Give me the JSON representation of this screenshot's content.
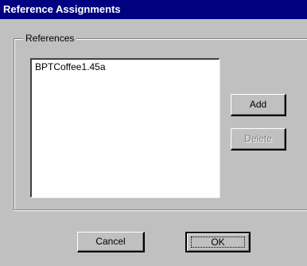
{
  "window": {
    "title": "Reference Assignments"
  },
  "references_group": {
    "label": "References",
    "items": [
      {
        "label": "BPTCoffee1.45a"
      }
    ]
  },
  "buttons": {
    "add_label": "Add",
    "delete_label": "Delete",
    "delete_enabled": false,
    "cancel_label": "Cancel",
    "ok_label": "OK"
  },
  "colors": {
    "title_bar": "#000080",
    "dialog_background": "#c0c0c0",
    "list_background": "#ffffff"
  }
}
